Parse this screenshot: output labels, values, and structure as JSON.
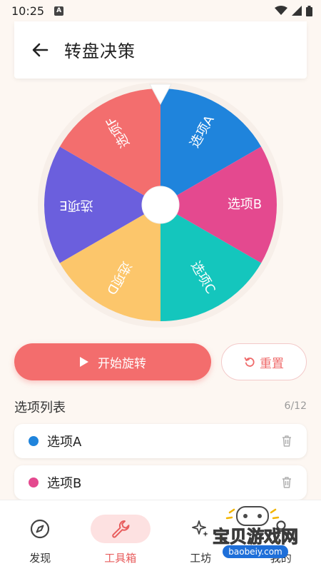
{
  "status_bar": {
    "time": "10:25",
    "badge": "A"
  },
  "header": {
    "title": "转盘决策"
  },
  "wheel": {
    "segments": [
      {
        "label": "选项A",
        "color": "#1f84dc"
      },
      {
        "label": "选项B",
        "color": "#e4498f"
      },
      {
        "label": "选项C",
        "color": "#14c6bd"
      },
      {
        "label": "选项D",
        "color": "#fcc66b"
      },
      {
        "label": "选项E",
        "color": "#6b5fdd"
      },
      {
        "label": "选项F",
        "color": "#f36e6e"
      }
    ]
  },
  "actions": {
    "spin_label": "开始旋转",
    "reset_label": "重置"
  },
  "options": {
    "title": "选项列表",
    "count": "6/12",
    "items": [
      {
        "label": "选项A",
        "color": "#1f84dc"
      },
      {
        "label": "选项B",
        "color": "#e4498f"
      }
    ]
  },
  "nav": {
    "items": [
      {
        "label": "发现",
        "icon": "compass-icon"
      },
      {
        "label": "工具箱",
        "icon": "wrench-icon"
      },
      {
        "label": "工坊",
        "icon": "sparkle-icon"
      },
      {
        "label": "我的",
        "icon": "user-icon"
      }
    ],
    "active_color": "#e85d5d"
  },
  "watermark": {
    "text": "宝贝游戏网",
    "url": "baobeiy.com"
  }
}
